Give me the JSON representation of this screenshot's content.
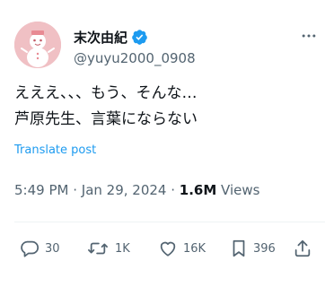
{
  "author": {
    "display_name": "末次由紀",
    "handle": "@yuyu2000_0908",
    "verified_color": "#1d9bf0",
    "avatar_icon": "snowman-avatar-icon"
  },
  "tweet": {
    "text": "えええ、、、もう、そんな…\n芦原先生、言葉にならない",
    "translate_label": "Translate post",
    "time": "5:49 PM",
    "separator": " · ",
    "date": "Jan 29, 2024",
    "views_count": "1.6M",
    "views_label": " Views"
  },
  "actions": {
    "reply_count": "30",
    "retweet_count": "1K",
    "like_count": "16K",
    "bookmark_count": "396"
  },
  "colors": {
    "text_primary": "#0f1419",
    "text_secondary": "#536471",
    "link": "#1d9bf0",
    "avatar_bg": "#f0c0c4"
  }
}
